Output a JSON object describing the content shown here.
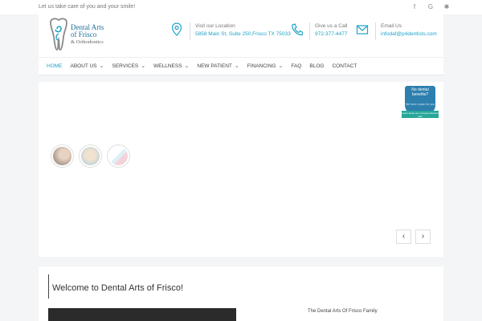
{
  "topbar": {
    "tagline": "Let us take care of you and your smile!",
    "social": [
      "facebook-icon",
      "google-icon",
      "yelp-icon"
    ],
    "social_glyphs": {
      "facebook": "f",
      "google": "G",
      "yelp": "✱"
    }
  },
  "logo": {
    "line1": "Dental Arts",
    "line2": "of Frisco",
    "line3": "& Orthodontics"
  },
  "contact": {
    "location_label": "Visit our Location",
    "location_value": "5858 Main St, Suite 250,Frisco TX 75033",
    "call_label": "Give us a Call",
    "call_value": "972-377-4477",
    "email_label": "Email Us",
    "email_value": "infodaf@p4dentists.com"
  },
  "nav": {
    "items": [
      {
        "label": "HOME",
        "active": true,
        "dropdown": false
      },
      {
        "label": "ABOUT US",
        "active": false,
        "dropdown": true
      },
      {
        "label": "SERVICES",
        "active": false,
        "dropdown": true
      },
      {
        "label": "WELLNESS",
        "active": false,
        "dropdown": true
      },
      {
        "label": "NEW PATIENT",
        "active": false,
        "dropdown": true
      },
      {
        "label": "FINANCING",
        "active": false,
        "dropdown": true
      },
      {
        "label": "FAQ",
        "active": false,
        "dropdown": false
      },
      {
        "label": "BLOG",
        "active": false,
        "dropdown": false
      },
      {
        "label": "CONTACT",
        "active": false,
        "dropdown": false
      }
    ],
    "chevron": "⌄"
  },
  "badge": {
    "title": "No dental benefits?",
    "sub": "We have a plan for you",
    "ribbon": "Learn about our In-house discount plan"
  },
  "slider": {
    "prev": "‹",
    "next": "›"
  },
  "welcome": {
    "title": "Welcome to Dental Arts of Frisco!",
    "family_label": "The Dental Arts Of Frisco Family"
  },
  "colors": {
    "accent": "#1fa3c8",
    "brand": "#1a6f9a",
    "badge_blue": "#2d7fae",
    "badge_green": "#27a79a"
  }
}
